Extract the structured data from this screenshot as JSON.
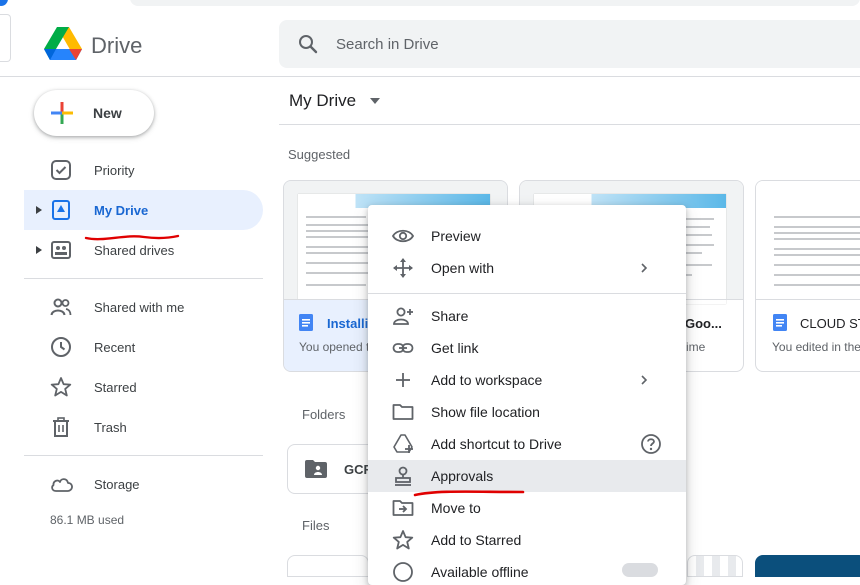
{
  "app": {
    "name": "Drive"
  },
  "search": {
    "placeholder": "Search in Drive"
  },
  "new_button": {
    "label": "New"
  },
  "sidebar": {
    "items": [
      {
        "label": "Priority",
        "icon": "priority-icon"
      },
      {
        "label": "My Drive",
        "icon": "my-drive-icon",
        "active": true
      },
      {
        "label": "Shared drives",
        "icon": "shared-drives-icon"
      },
      {
        "label": "Shared with me",
        "icon": "shared-with-me-icon"
      },
      {
        "label": "Recent",
        "icon": "clock-icon"
      },
      {
        "label": "Starred",
        "icon": "star-icon"
      },
      {
        "label": "Trash",
        "icon": "trash-icon"
      },
      {
        "label": "Storage",
        "icon": "cloud-icon"
      }
    ],
    "storage_used": "86.1 MB used"
  },
  "main": {
    "title": "My Drive",
    "suggested_label": "Suggested",
    "folders_label": "Folders",
    "files_label": "Files",
    "cards": [
      {
        "name": "Installi",
        "sub": "You opened t"
      },
      {
        "name": "Goo...",
        "sub": "ime"
      },
      {
        "name": "CLOUD ST",
        "sub": "You edited in the"
      }
    ],
    "folder_name": "GCF"
  },
  "context_menu": {
    "items": [
      {
        "label": "Preview",
        "icon": "eye-icon"
      },
      {
        "label": "Open with",
        "icon": "move-arrows-icon",
        "submenu": true
      },
      {
        "label": "Share",
        "icon": "person-add-icon"
      },
      {
        "label": "Get link",
        "icon": "link-icon"
      },
      {
        "label": "Add to workspace",
        "icon": "plus-icon",
        "submenu": true
      },
      {
        "label": "Show file location",
        "icon": "folder-icon"
      },
      {
        "label": "Add shortcut to Drive",
        "icon": "shortcut-icon",
        "help": true
      },
      {
        "label": "Approvals",
        "icon": "approval-stamp-icon",
        "highlighted": true
      },
      {
        "label": "Move to",
        "icon": "move-to-icon"
      },
      {
        "label": "Add to Starred",
        "icon": "star-icon"
      },
      {
        "label": "Available offline",
        "icon": "offline-icon"
      }
    ]
  },
  "colors": {
    "accent": "#1a73e8",
    "active_bg": "#e8f0fe",
    "annotation_red": "#e00000",
    "menu_highlight": "#e8eaed"
  }
}
